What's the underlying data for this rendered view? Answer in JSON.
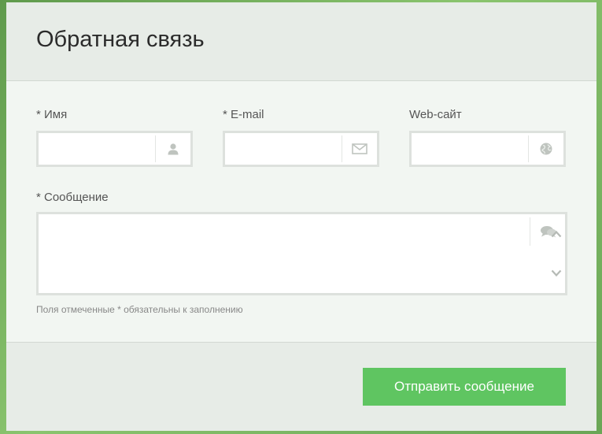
{
  "dialog": {
    "title": "Обратная связь"
  },
  "form": {
    "name": {
      "label": "* Имя",
      "value": "",
      "placeholder": "",
      "icon": "user-icon"
    },
    "email": {
      "label": "* E-mail",
      "value": "",
      "placeholder": "",
      "icon": "envelope-icon"
    },
    "website": {
      "label": "Web-сайт",
      "value": "",
      "placeholder": "",
      "icon": "globe-icon"
    },
    "message": {
      "label": "* Сообщение",
      "value": "",
      "placeholder": "",
      "icon": "speech-bubbles-icon"
    },
    "required_note": "Поля отмеченные * обязательны к заполнению",
    "submit_label": "Отправить сообщение"
  },
  "colors": {
    "accent": "#5fc561",
    "background": "#7fb069",
    "icon": "#bfc4bf"
  }
}
